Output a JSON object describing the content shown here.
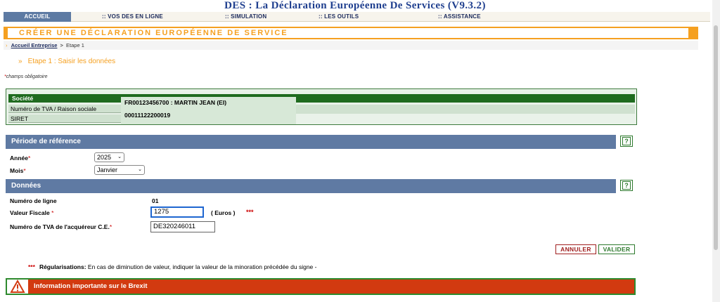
{
  "app": {
    "title": "DES : La Déclaration Européenne De Services (V9.3.2)"
  },
  "nav": {
    "items": [
      {
        "label": "Accueil"
      },
      {
        "label": ":: Vos DES En Ligne"
      },
      {
        "label": ":: Simulation"
      },
      {
        "label": ":: Les Outils"
      },
      {
        "label": ":: Assistance"
      }
    ]
  },
  "banner": {
    "title": "Créer une déclaration européenne de service"
  },
  "breadcrumb": {
    "link": "Accueil Entreprise",
    "separator": ">",
    "current": "Etape 1"
  },
  "step": {
    "arrow": "»",
    "label": "Etape 1 : Saisir les données"
  },
  "required_note": {
    "star": "*",
    "text": "champs obligatoire"
  },
  "societe": {
    "header": "Société",
    "rows": [
      {
        "label": "Numéro de TVA / Raison sociale",
        "value": "FR00123456700 : MARTIN JEAN (EI)"
      },
      {
        "label": "SIRET",
        "value": "00011122200019"
      }
    ]
  },
  "periode": {
    "header": "Période de référence",
    "help": "?",
    "annee_label": "Année",
    "annee_value": "2025",
    "mois_label": "Mois",
    "mois_value": "Janvier",
    "star": "*"
  },
  "donnees": {
    "header": "Données",
    "help": "?",
    "numero_ligne_label": "Numéro de ligne",
    "numero_ligne_value": "01",
    "valeur_fiscale_label": "Valeur Fiscale",
    "valeur_fiscale_value": "1275",
    "valeur_unit": "( Euros )",
    "valeur_stars": "***",
    "tva_acquereur_label": "Numéro de TVA de l'acquéreur C.E.",
    "tva_acquereur_value": "DE320246011",
    "star": "*"
  },
  "buttons": {
    "annuler": "ANNULER",
    "valider": "VALIDER"
  },
  "regularisations": {
    "stars": "***",
    "label": "Régularisations:",
    "text": " En cas de diminution de valeur, indiquer la valeur de la minoration précédée du signe  -"
  },
  "brexit": {
    "text": "Information importante sur le Brexit"
  },
  "colors": {
    "accent_orange": "#f5a020",
    "nav_blue": "#5f7aa3",
    "societe_green": "#1f6b1f",
    "brexit_red": "#d23a10"
  }
}
